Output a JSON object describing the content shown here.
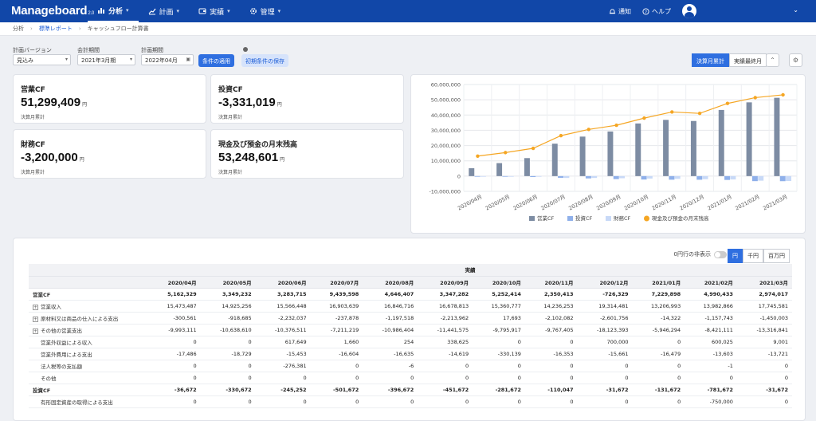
{
  "app": {
    "logo": "Manageboard",
    "logo_version": "2.0",
    "nav": [
      {
        "label": "分析",
        "icon": "bar-chart-icon",
        "active": true
      },
      {
        "label": "計画",
        "icon": "line-chart-icon",
        "active": false
      },
      {
        "label": "実績",
        "icon": "wallet-icon",
        "active": false
      },
      {
        "label": "管理",
        "icon": "gear-icon",
        "active": false
      }
    ],
    "notifications_label": "通知",
    "help_label": "ヘルプ"
  },
  "breadcrumb": [
    "分析",
    "標準レポート",
    "キャッシュフロー計算書"
  ],
  "filters": {
    "version_label": "計画バージョン",
    "version_value": "見込み",
    "fiscal_label": "会計期間",
    "fiscal_value": "2021年3月期",
    "period_label": "計画期間",
    "period_value": "2022年04月",
    "apply_label": "条件の適用",
    "save_label": "初期条件の保存"
  },
  "view_toggle": [
    "決算月累計",
    "実績最終月"
  ],
  "kpis": [
    {
      "title": "営業CF",
      "value": "51,299,409",
      "unit": "円",
      "sub": "決算月累計"
    },
    {
      "title": "投資CF",
      "value": "-3,331,019",
      "unit": "円",
      "sub": "決算月累計"
    },
    {
      "title": "財務CF",
      "value": "-3,200,000",
      "unit": "円",
      "sub": "決算月累計"
    },
    {
      "title": "現金及び預金の月末残高",
      "value": "53,248,601",
      "unit": "円",
      "sub": "決算月累計"
    }
  ],
  "chart_data": {
    "type": "bar",
    "categories": [
      "2020/04月",
      "2020/05月",
      "2020/06月",
      "2020/07月",
      "2020/08月",
      "2020/09月",
      "2020/10月",
      "2020/11月",
      "2020/12月",
      "2021/01月",
      "2021/02月",
      "2021/03月"
    ],
    "ylim": [
      -10000000,
      60000000
    ],
    "yticks": [
      "60,000,000",
      "50,000,000",
      "40,000,000",
      "30,000,000",
      "20,000,000",
      "10,000,000",
      "0",
      "-10,000,000"
    ],
    "series": [
      {
        "name": "営業CF",
        "color": "#7d8ca3",
        "type": "bar",
        "values": [
          5162329,
          8511561,
          11795276,
          21234874,
          25881281,
          29228563,
          34480977,
          36831390,
          36105061,
          43334959,
          48325392,
          51299409
        ]
      },
      {
        "name": "投資CF",
        "color": "#8fb0ea",
        "type": "bar",
        "values": [
          -36672,
          -367344,
          -612596,
          -1114268,
          -1510940,
          -1962612,
          -2244284,
          -2354331,
          -2386003,
          -2517675,
          -3299347,
          -3331019
        ]
      },
      {
        "name": "財務CF",
        "color": "#c8d9f7",
        "type": "bar",
        "values": [
          0,
          -200000,
          -400000,
          -1200000,
          -1200000,
          -1400000,
          -1600000,
          -1800000,
          -2000000,
          -2200000,
          -3000000,
          -3200000
        ]
      },
      {
        "name": "現金及び預金の月末残高",
        "color": "#f5a623",
        "type": "line",
        "values": [
          13100000,
          15400000,
          18200000,
          26500000,
          30600000,
          33300000,
          38000000,
          42000000,
          41100000,
          47600000,
          51400000,
          53248601
        ]
      }
    ],
    "legend_position": "bottom"
  },
  "table": {
    "zero_hide_label": "0円行の非表示",
    "units": [
      "円",
      "千円",
      "百万円"
    ],
    "group_header": "実績",
    "columns": [
      "2020/04月",
      "2020/05月",
      "2020/06月",
      "2020/07月",
      "2020/08月",
      "2020/09月",
      "2020/10月",
      "2020/11月",
      "2020/12月",
      "2021/01月",
      "2021/02月",
      "2021/03月"
    ],
    "rows": [
      {
        "label": "営業CF",
        "bold": true,
        "expand": false,
        "indent": 0,
        "values": [
          "5,162,329",
          "3,349,232",
          "3,283,715",
          "9,439,598",
          "4,646,407",
          "3,347,282",
          "5,252,414",
          "2,350,413",
          "-726,329",
          "7,229,898",
          "4,990,433",
          "2,974,017"
        ]
      },
      {
        "label": "営業収入",
        "bold": false,
        "expand": true,
        "indent": 0,
        "values": [
          "15,473,487",
          "14,925,256",
          "15,566,448",
          "16,903,639",
          "16,846,716",
          "16,678,813",
          "15,360,777",
          "14,236,253",
          "19,314,481",
          "13,206,993",
          "13,982,866",
          "17,745,581"
        ]
      },
      {
        "label": "原材料又は商品の仕入による支出",
        "bold": false,
        "expand": true,
        "indent": 0,
        "values": [
          "-300,561",
          "-918,685",
          "-2,232,037",
          "-237,878",
          "-1,197,518",
          "-2,213,962",
          "17,693",
          "-2,102,082",
          "-2,601,756",
          "-14,322",
          "-1,157,743",
          "-1,450,003"
        ]
      },
      {
        "label": "その他の営業支出",
        "bold": false,
        "expand": true,
        "indent": 0,
        "values": [
          "-9,993,111",
          "-10,638,610",
          "-10,376,511",
          "-7,211,219",
          "-10,986,404",
          "-11,441,575",
          "-9,795,917",
          "-9,767,405",
          "-18,123,393",
          "-5,946,294",
          "-8,421,111",
          "-13,316,841"
        ]
      },
      {
        "label": "営業外収益による収入",
        "bold": false,
        "expand": false,
        "indent": 1,
        "values": [
          "0",
          "0",
          "617,649",
          "1,660",
          "254",
          "338,625",
          "0",
          "0",
          "700,000",
          "0",
          "600,025",
          "9,001"
        ]
      },
      {
        "label": "営業外費用による支出",
        "bold": false,
        "expand": false,
        "indent": 1,
        "values": [
          "-17,486",
          "-18,729",
          "-15,453",
          "-16,604",
          "-16,635",
          "-14,619",
          "-330,139",
          "-16,353",
          "-15,661",
          "-16,479",
          "-13,603",
          "-13,721"
        ]
      },
      {
        "label": "法人税等の支払額",
        "bold": false,
        "expand": false,
        "indent": 1,
        "values": [
          "0",
          "0",
          "-276,381",
          "0",
          "-6",
          "0",
          "0",
          "0",
          "0",
          "0",
          "-1",
          "0"
        ]
      },
      {
        "label": "その他",
        "bold": false,
        "expand": false,
        "indent": 1,
        "values": [
          "0",
          "0",
          "0",
          "0",
          "0",
          "0",
          "0",
          "0",
          "0",
          "0",
          "0",
          "0"
        ]
      },
      {
        "label": "投資CF",
        "bold": true,
        "expand": false,
        "indent": 0,
        "values": [
          "-36,672",
          "-330,672",
          "-245,252",
          "-501,672",
          "-396,672",
          "-451,672",
          "-281,672",
          "-110,047",
          "-31,672",
          "-131,672",
          "-781,672",
          "-31,672"
        ]
      },
      {
        "label": "有形固定資産の取得による支出",
        "bold": false,
        "expand": false,
        "indent": 1,
        "values": [
          "0",
          "0",
          "0",
          "0",
          "0",
          "0",
          "0",
          "0",
          "0",
          "0",
          "-750,000",
          "0"
        ]
      }
    ]
  }
}
